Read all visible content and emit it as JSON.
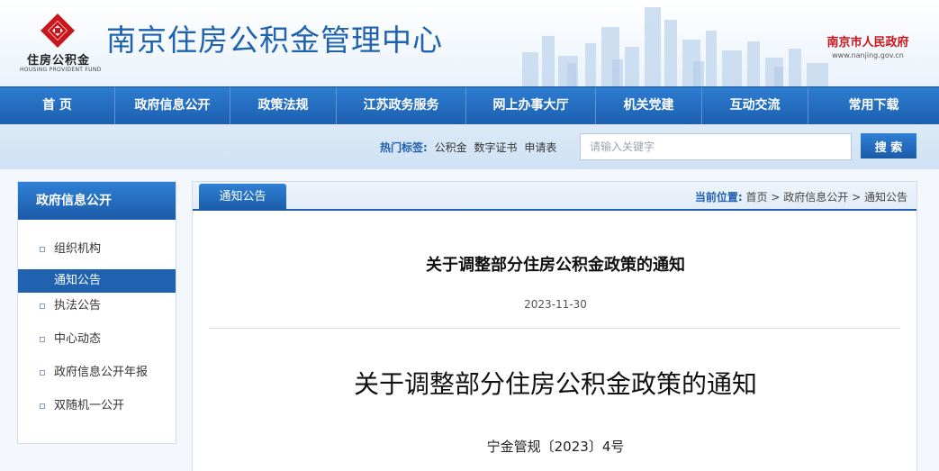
{
  "header": {
    "logo_text": "住房公积金",
    "logo_subtext": "HOUSING PROVIDENT FUND",
    "site_title": "南京住房公积金管理中心",
    "gov_name": "南京市人民政府",
    "gov_url": "www.nanjing.gov.cn"
  },
  "nav": {
    "items": [
      {
        "label": "首 页"
      },
      {
        "label": "政府信息公开"
      },
      {
        "label": "政策法规"
      },
      {
        "label": "江苏政务服务"
      },
      {
        "label": "网上办事大厅"
      },
      {
        "label": "机关党建"
      },
      {
        "label": "互动交流"
      },
      {
        "label": "常用下载"
      }
    ]
  },
  "search": {
    "hot_label": "热门标签:",
    "hot_tags": [
      "公积金",
      "数字证书",
      "申请表"
    ],
    "placeholder": "请输入关键字",
    "button_label": "搜 索"
  },
  "sidebar": {
    "title": "政府信息公开",
    "items": [
      {
        "label": "组织机构",
        "active": false
      },
      {
        "label": "通知公告",
        "active": true
      },
      {
        "label": "执法公告",
        "active": false
      },
      {
        "label": "中心动态",
        "active": false
      },
      {
        "label": "政府信息公开年报",
        "active": false
      },
      {
        "label": "双随机一公开",
        "active": false
      }
    ]
  },
  "main": {
    "tab_label": "通知公告",
    "breadcrumb": {
      "label": "当前位置:",
      "items": [
        "首页",
        "政府信息公开",
        "通知公告"
      ],
      "separator": ">"
    },
    "article_title": "关于调整部分住房公积金政策的通知",
    "article_date": "2023-11-30",
    "doc_title": "关于调整部分住房公积金政策的通知",
    "doc_number": "宁金管规〔2023〕4号"
  },
  "colors": {
    "brand_blue": "#1f63b0",
    "gov_red": "#c8161d",
    "logo_red": "#c8161d"
  }
}
